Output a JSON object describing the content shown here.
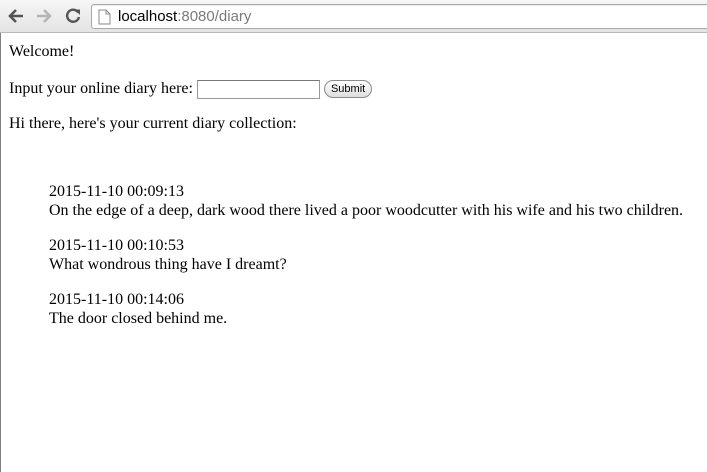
{
  "browser": {
    "url_host": "localhost",
    "url_rest": ":8080/diary"
  },
  "page": {
    "welcome": "Welcome!",
    "input_label": "Input your online diary here:",
    "input_value": "",
    "submit_label": "Submit",
    "intro": "Hi there, here's your current diary collection:"
  },
  "entries": [
    {
      "date": "2015-11-10 00:09:13",
      "text": "On the edge of a deep, dark wood there lived a poor woodcutter with his wife and his two children."
    },
    {
      "date": "2015-11-10 00:10:53",
      "text": "What wondrous thing have I dreamt?"
    },
    {
      "date": "2015-11-10 00:14:06",
      "text": "The door closed behind me."
    }
  ],
  "icons": {
    "back": "back-arrow-icon",
    "forward": "forward-arrow-icon",
    "reload": "reload-icon",
    "page": "page-icon"
  },
  "colors": {
    "url_host": "#000000",
    "url_rest": "#7a7a7a",
    "forward_disabled": "#b5b5b5",
    "nav_active": "#555555"
  }
}
